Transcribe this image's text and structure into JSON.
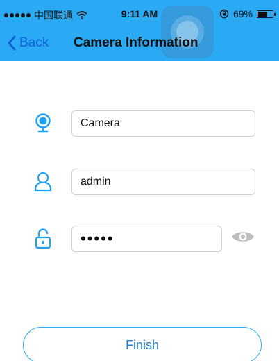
{
  "status_bar": {
    "carrier": "中国联通",
    "time": "9:11 AM",
    "battery": "69%",
    "battery_level": 0.69
  },
  "nav": {
    "back_label": "Back",
    "title": "Camera Information"
  },
  "form": {
    "camera_name": {
      "value": "Camera",
      "icon": "camera-icon"
    },
    "username": {
      "value": "admin",
      "icon": "user-icon"
    },
    "password": {
      "masked_value": "•••••",
      "icon": "lock-icon",
      "toggle_icon": "eye-icon"
    }
  },
  "finish_label": "Finish",
  "colors": {
    "header": "#2aaaf4",
    "back_link": "#0b63d8",
    "icon": "#1da1f2",
    "finish_text": "#1f7fd0"
  }
}
